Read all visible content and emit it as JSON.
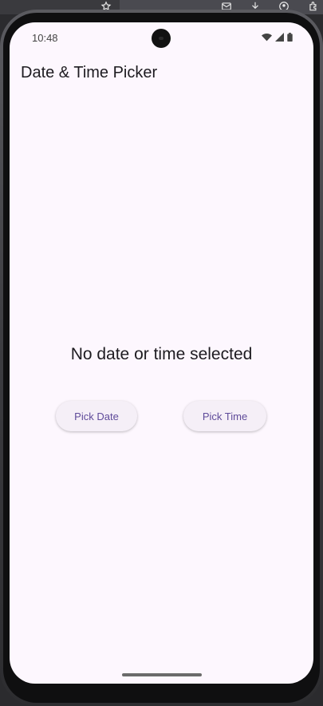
{
  "status_bar": {
    "time": "10:48"
  },
  "app_bar": {
    "title": "Date & Time Picker"
  },
  "main": {
    "selection_text": "No date or time selected",
    "pick_date_label": "Pick Date",
    "pick_time_label": "Pick Time"
  },
  "colors": {
    "background": "#fdf7fe",
    "button_bg": "#f5eff7",
    "button_text": "#5f4b9a",
    "text": "#1d1b20"
  },
  "icons": {
    "host_toolbar": [
      "star-icon",
      "mail-icon",
      "download-icon",
      "account-icon",
      "extension-icon"
    ],
    "status": [
      "wifi-icon",
      "signal-icon",
      "battery-icon"
    ]
  }
}
